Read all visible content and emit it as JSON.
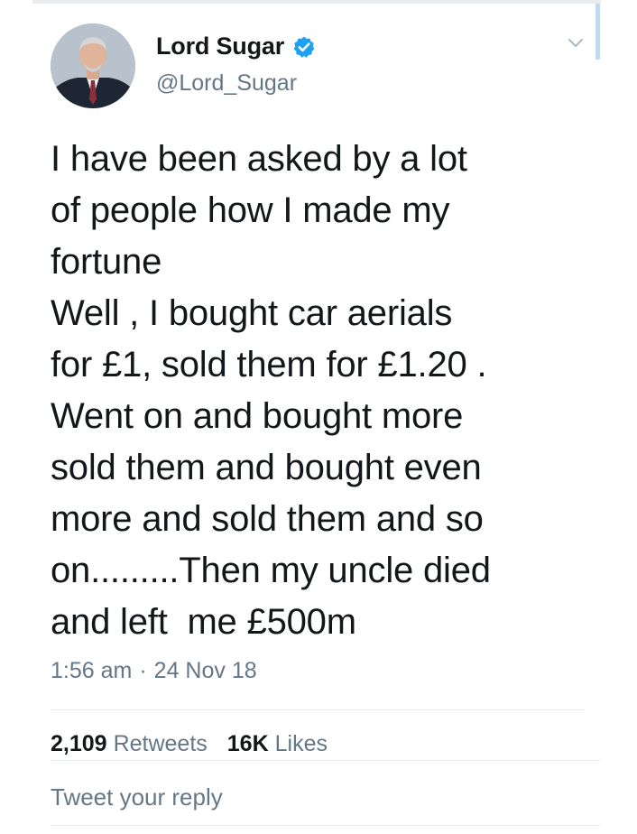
{
  "author": {
    "display_name": "Lord Sugar",
    "handle": "@Lord_Sugar",
    "verified": true,
    "verified_color": "#1da1f2"
  },
  "tweet": {
    "lines": [
      "I have been asked by a lot",
      "of people how I made my",
      "fortune",
      "Well , I bought car aerials",
      "for £1, sold them for £1.20 .",
      "Went on and bought more",
      "sold them and bought even",
      "more and sold them and so",
      "on.........Then my uncle died",
      "and left  me £500m"
    ],
    "time": "1:56 am",
    "separator": "·",
    "date": "24 Nov 18"
  },
  "stats": {
    "retweets_count": "2,109",
    "retweets_label": "Retweets",
    "likes_count": "16K",
    "likes_label": "Likes"
  },
  "reply": {
    "placeholder": "Tweet your reply"
  },
  "icons": {
    "verified": "verified-badge-icon",
    "caret": "chevron-down-icon"
  },
  "colors": {
    "text": "#14171a",
    "secondary": "#657786",
    "accent": "#1da1f2",
    "divider": "#e6ecf0"
  }
}
